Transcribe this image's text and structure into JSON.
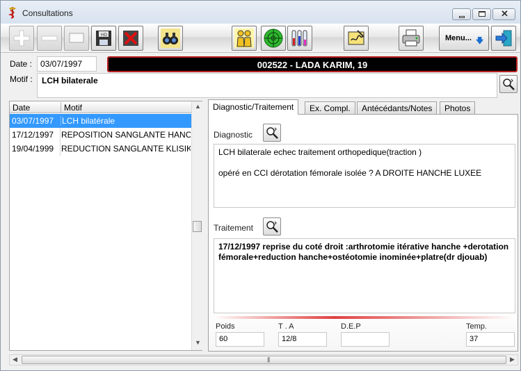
{
  "window": {
    "title": "Consultations"
  },
  "toolbar": {
    "menu_label": "Menu...",
    "buttons": [
      "add-icon",
      "remove-icon",
      "blank-icon",
      "save-disk-icon",
      "delete-x-icon",
      "binoculars-icon",
      "persons-icon",
      "radar-icon",
      "test-tubes-icon",
      "signature-icon",
      "printer-icon",
      "menu-arrow-icon",
      "exit-icon"
    ]
  },
  "form": {
    "date_label": "Date :",
    "date_value": "03/07/1997",
    "patient": "002522 - LADA KARIM, 19",
    "motif_label": "Motif :",
    "motif_value": "LCH bilaterale"
  },
  "list": {
    "headers": {
      "date": "Date",
      "motif": "Motif"
    },
    "rows": [
      {
        "date": "03/07/1997",
        "motif": "LCH bilatérale",
        "selected": true
      },
      {
        "date": "17/12/1997",
        "motif": "REPOSITION SANGLANTE HANCHE",
        "selected": false
      },
      {
        "date": "19/04/1999",
        "motif": "REDUCTION SANGLANTE KLISIKI",
        "selected": false
      }
    ]
  },
  "tabs": [
    {
      "label": "Diagnostic/Traitement",
      "active": true
    },
    {
      "label": "Ex. Compl.",
      "active": false
    },
    {
      "label": "Antécédants/Notes",
      "active": false
    },
    {
      "label": "Photos",
      "active": false
    }
  ],
  "diagnostic": {
    "label": "Diagnostic",
    "line1": "LCH bilaterale echec traitement orthopedique(traction )",
    "line2": "opéré en CCI dérotation fémorale isolée ? A DROITE HANCHE LUXEE"
  },
  "traitement": {
    "label": "Traitement",
    "text": "17/12/1997 reprise du coté droit :arthrotomie itérative hanche +derotation fémorale+reduction hanche+ostéotomie inominée+platre(dr djouab)"
  },
  "vitals": {
    "poids": {
      "label": "Poids",
      "value": "60"
    },
    "ta": {
      "label": "T . A",
      "value": "12/8"
    },
    "dep": {
      "label": "D.E.P",
      "value": ""
    },
    "temp": {
      "label": "Temp.",
      "value": "37"
    }
  },
  "colors": {
    "selection": "#3399ff",
    "patient_bar": "#000000",
    "patient_border": "#bb2222",
    "accent_bar": "#e04040"
  }
}
